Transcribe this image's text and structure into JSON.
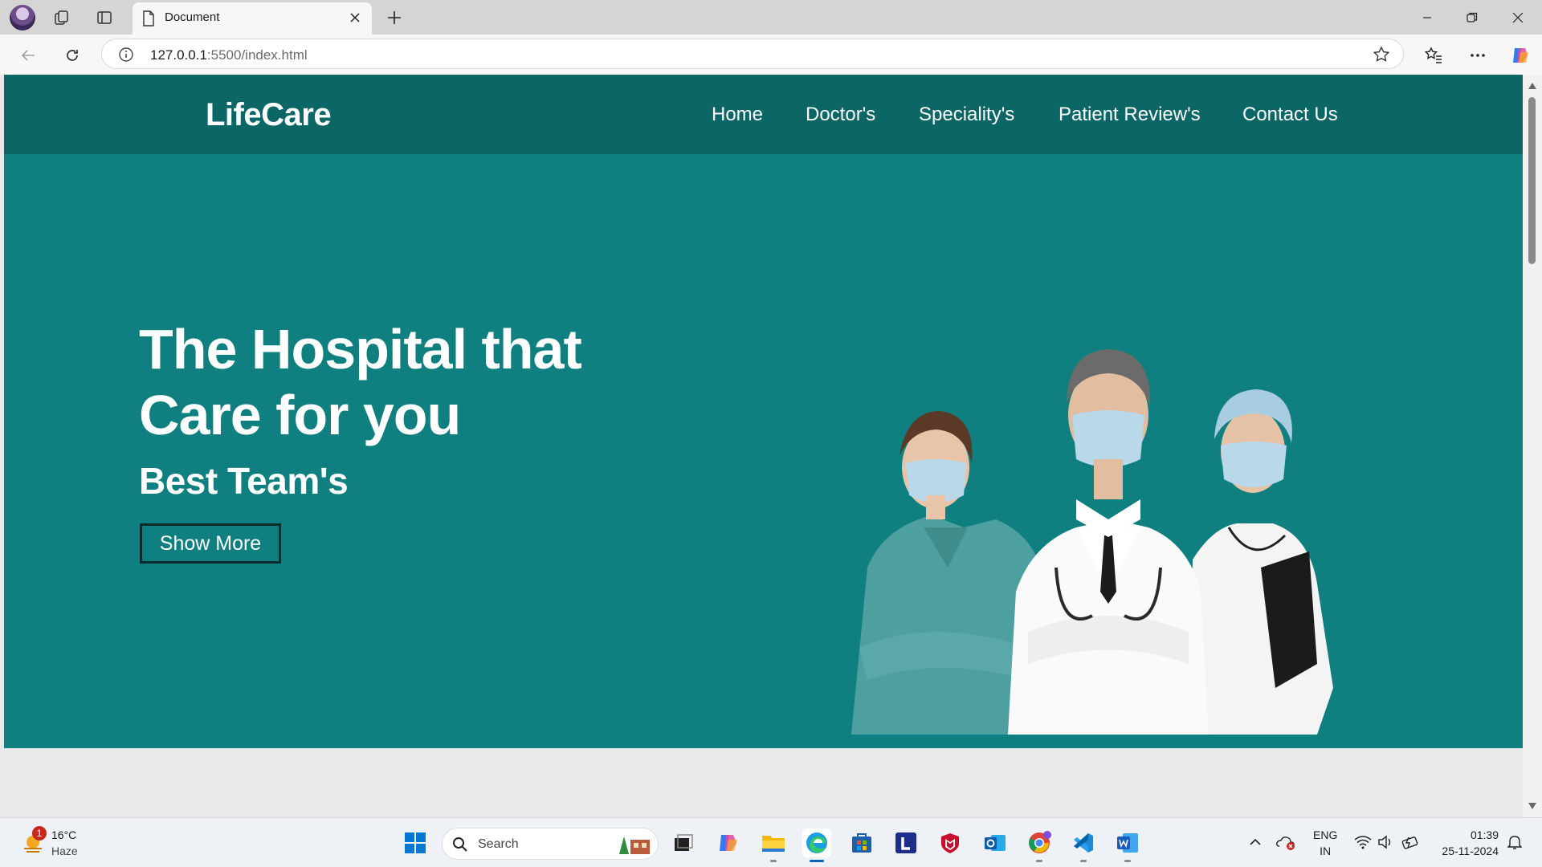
{
  "browser": {
    "tab_title": "Document",
    "url_host": "127.0.0.1",
    "url_rest": ":5500/index.html"
  },
  "site": {
    "brand": "LifeCare",
    "nav": [
      "Home",
      "Doctor's",
      "Speciality's",
      "Patient Review's",
      "Contact Us"
    ],
    "hero_title": "The Hospital that Care for you",
    "hero_subtitle": "Best Team's",
    "cta_label": "Show More"
  },
  "colors": {
    "navbar": "#0c6666",
    "hero": "#107f7f",
    "text": "#ffffff"
  },
  "taskbar": {
    "weather_temp": "16°C",
    "weather_desc": "Haze",
    "weather_badge": "1",
    "search_label": "Search",
    "lang_line1": "ENG",
    "lang_line2": "IN",
    "time": "01:39",
    "date": "25-11-2024",
    "apps": [
      "windows-start",
      "search",
      "task-view",
      "copilot",
      "file-explorer",
      "edge",
      "microsoft-store",
      "linkedin-style-L",
      "mcafee",
      "outlook",
      "chrome",
      "vscode",
      "word"
    ]
  }
}
